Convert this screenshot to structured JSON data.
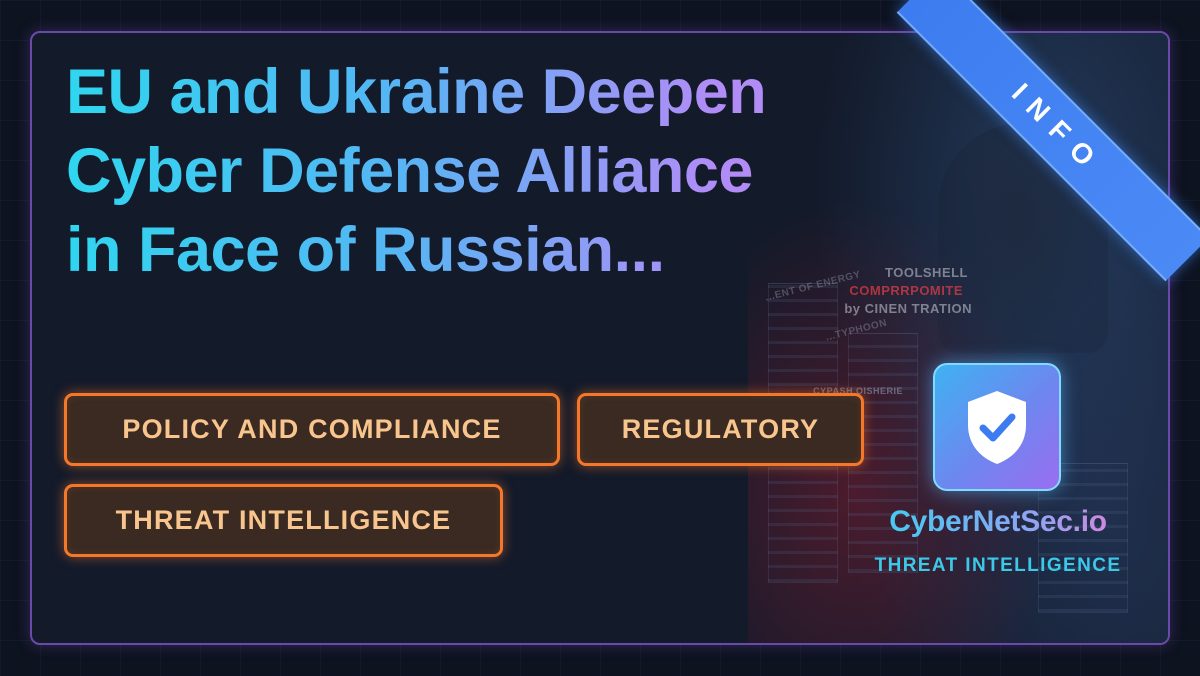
{
  "headline": "EU and Ukraine Deepen Cyber Defense Alliance in Face of Russian...",
  "tags": [
    "POLICY AND COMPLIANCE",
    "REGULATORY",
    "THREAT INTELLIGENCE"
  ],
  "ribbon": {
    "label": "INFO"
  },
  "brand": {
    "name": "CyberNetSec.io",
    "tagline": "THREAT INTELLIGENCE"
  },
  "background_art_text": {
    "line1": "TOOLSHELL",
    "line2": "COMPRRPOMITE",
    "line3": "by CINEN TRATION",
    "line4": "...ENT OF ENERGY",
    "line5": "...TYPHOON",
    "line6": "CYPASH OISHERIE"
  },
  "icons": {
    "logo": "shield-check-icon"
  },
  "colors": {
    "tag_border": "#f5782a",
    "tag_text": "#f9c58e",
    "ribbon": "#3c7cf0",
    "card_border": "#6a49a8"
  }
}
